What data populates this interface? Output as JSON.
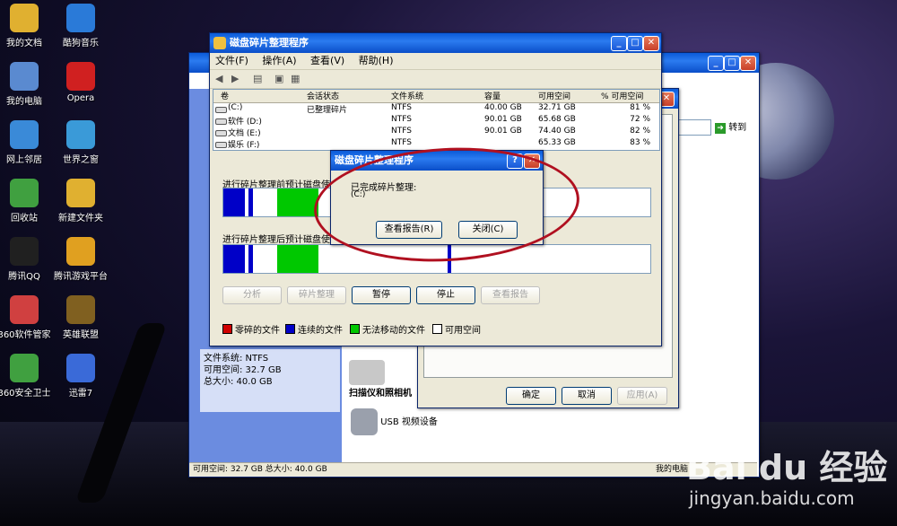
{
  "desktop": {
    "icons": [
      {
        "label": "我的文档",
        "icon": "folder-icon"
      },
      {
        "label": "酷狗音乐",
        "icon": "kugou-icon"
      },
      {
        "label": "我的电脑",
        "icon": "computer-icon"
      },
      {
        "label": "Opera",
        "icon": "opera-icon"
      },
      {
        "label": "网上邻居",
        "icon": "network-icon"
      },
      {
        "label": "世界之窗",
        "icon": "browser-icon"
      },
      {
        "label": "回收站",
        "icon": "recycle-bin-icon"
      },
      {
        "label": "新建文件夹",
        "icon": "folder-icon"
      },
      {
        "label": "腾讯QQ",
        "icon": "qq-icon"
      },
      {
        "label": "腾讯游戏平台",
        "icon": "game-platform-icon"
      },
      {
        "label": "360软件管家",
        "icon": "360-manager-icon"
      },
      {
        "label": "英雄联盟",
        "icon": "lol-icon"
      },
      {
        "label": "360安全卫士",
        "icon": "360-guard-icon"
      },
      {
        "label": "迅雷7",
        "icon": "thunder-icon"
      }
    ]
  },
  "defrag": {
    "title": "磁盘碎片整理程序",
    "menu": [
      "文件(F)",
      "操作(A)",
      "查看(V)",
      "帮助(H)"
    ],
    "columns": [
      "卷",
      "会话状态",
      "文件系统",
      "容量",
      "可用空间",
      "% 可用空间"
    ],
    "volumes": [
      [
        "(C:)",
        "已整理碎片",
        "NTFS",
        "40.00 GB",
        "32.71 GB",
        "81 %"
      ],
      [
        "软件 (D:)",
        "",
        "NTFS",
        "90.01 GB",
        "65.68 GB",
        "72 %"
      ],
      [
        "文档 (E:)",
        "",
        "NTFS",
        "90.01 GB",
        "74.40 GB",
        "82 %"
      ],
      [
        "娱乐 (F:)",
        "",
        "NTFS",
        "",
        "65.33 GB",
        "83 %"
      ]
    ],
    "before_label": "进行碎片整理前预计磁盘使用",
    "after_label": "进行碎片整理后预计磁盘使用",
    "buttons": {
      "analyze": "分析",
      "defrag": "碎片整理",
      "pause": "暂停",
      "stop": "停止",
      "report": "查看报告"
    },
    "legend": [
      {
        "label": "零碎的文件",
        "color": "#d00000"
      },
      {
        "label": "连续的文件",
        "color": "#0000c8"
      },
      {
        "label": "无法移动的文件",
        "color": "#00c800"
      },
      {
        "label": "可用空间",
        "color": "#ffffff"
      }
    ]
  },
  "dialog": {
    "title": "磁盘碎片整理程序",
    "message": "已完成碎片整理:",
    "volume": "(C:)",
    "view_report": "查看报告(R)",
    "close": "关闭(C)"
  },
  "explorer": {
    "goto": "转到",
    "sidebar_lines": [
      "文件系统: NTFS",
      "可用空间: 32.7 GB",
      "总大小: 40.0 GB"
    ],
    "device1": "扫描仪和照相机",
    "device2": "USB 视频设备",
    "status_left": "可用空间: 32.7 GB 总大小: 40.0 GB",
    "status_right": "我的电脑"
  },
  "props": {
    "ok": "确定",
    "cancel": "取消",
    "apply": "应用(A)"
  },
  "watermark": {
    "brand": "Bai du 经验",
    "url": "jingyan.baidu.com"
  }
}
